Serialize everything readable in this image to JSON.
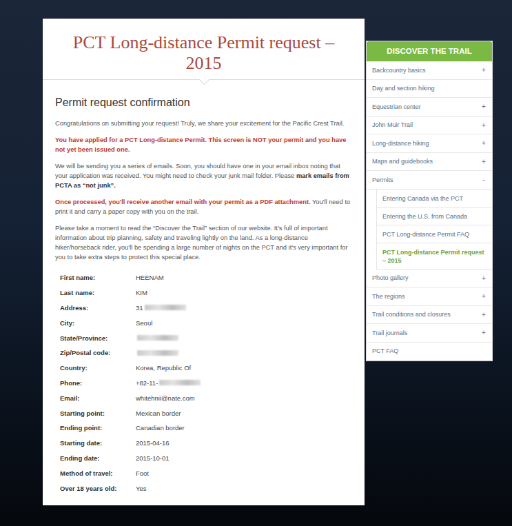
{
  "page": {
    "title": "PCT Long-distance Permit request – 2015",
    "heading": "Permit request confirmation",
    "paragraphs": [
      [
        {
          "style": "plain",
          "text": "Congratulations on submitting your request! Truly, we share your excitement for the Pacific Crest Trail."
        }
      ],
      [
        {
          "style": "alert",
          "text": "You have applied for a PCT Long-distance Permit. This screen is NOT your permit and you have not yet been issued one."
        }
      ],
      [
        {
          "style": "plain",
          "text": "We will be sending you a series of emails. Soon, you should have one in your email inbox noting that your application was received. You might need to check your junk mail folder. Please "
        },
        {
          "style": "bold",
          "text": "mark emails from PCTA as “not junk”."
        }
      ],
      [
        {
          "style": "alert",
          "text": "Once processed, you'll receive another email with your permit as a PDF attachment."
        },
        {
          "style": "plain",
          "text": " You'll need to print it and carry a paper copy with you on the trail."
        }
      ],
      [
        {
          "style": "plain",
          "text": "Please take a moment to read the “Discover the Trail” section of our website. It's full of important information about trip planning, safety and traveling lightly on the land. As a long-distance hiker/horseback rider, you'll be spending a large number of nights on the PCT and it's very important for you to take extra steps to protect this special place."
        }
      ]
    ]
  },
  "details": [
    {
      "label": "First name:",
      "value": "HEENAM",
      "redacted": false
    },
    {
      "label": "Last name:",
      "value": "KIM",
      "redacted": false
    },
    {
      "label": "Address:",
      "value": "31",
      "redacted": true
    },
    {
      "label": "City:",
      "value": "Seoul",
      "redacted": false
    },
    {
      "label": "State/Province:",
      "value": "",
      "redacted": true
    },
    {
      "label": "Zip/Postal code:",
      "value": "",
      "redacted": true
    },
    {
      "label": "Country:",
      "value": "Korea, Republic Of",
      "redacted": false
    },
    {
      "label": "Phone:",
      "value": "+82-11-",
      "redacted": true
    },
    {
      "label": "Email:",
      "value": "whitehnii@nate.com",
      "redacted": false
    },
    {
      "label": "Starting point:",
      "value": "Mexican border",
      "redacted": false
    },
    {
      "label": "Ending point:",
      "value": "Canadian border",
      "redacted": false
    },
    {
      "label": "Starting date:",
      "value": "2015-04-16",
      "redacted": false
    },
    {
      "label": "Ending date:",
      "value": "2015-10-01",
      "redacted": false
    },
    {
      "label": "Method of travel:",
      "value": "Foot",
      "redacted": false
    },
    {
      "label": "Over 18 years old:",
      "value": "Yes",
      "redacted": false
    }
  ],
  "sidebar": {
    "title": "DISCOVER THE TRAIL",
    "items": [
      {
        "label": "Backcountry basics",
        "toggle": "+",
        "expanded": false,
        "children": []
      },
      {
        "label": "Day and section hiking",
        "toggle": "",
        "expanded": false,
        "children": []
      },
      {
        "label": "Equestrian center",
        "toggle": "+",
        "expanded": false,
        "children": []
      },
      {
        "label": "John Muir Trail",
        "toggle": "+",
        "expanded": false,
        "children": []
      },
      {
        "label": "Long-distance hiking",
        "toggle": "+",
        "expanded": false,
        "children": []
      },
      {
        "label": "Maps and guidebooks",
        "toggle": "+",
        "expanded": false,
        "children": []
      },
      {
        "label": "Permits",
        "toggle": "-",
        "expanded": true,
        "children": [
          {
            "label": "Entering Canada via the PCT",
            "selected": false
          },
          {
            "label": "Entering the U.S. from Canada",
            "selected": false
          },
          {
            "label": "PCT Long-distance Permit FAQ",
            "selected": false
          },
          {
            "label": "PCT Long-distance Permit request – 2015",
            "selected": true
          }
        ]
      },
      {
        "label": "Photo gallery",
        "toggle": "+",
        "expanded": false,
        "children": []
      },
      {
        "label": "The regions",
        "toggle": "+",
        "expanded": false,
        "children": []
      },
      {
        "label": "Trail conditions and closures",
        "toggle": "+",
        "expanded": false,
        "children": []
      },
      {
        "label": "Trail journals",
        "toggle": "+",
        "expanded": false,
        "children": []
      },
      {
        "label": "PCT FAQ",
        "toggle": "",
        "expanded": false,
        "children": []
      }
    ]
  }
}
